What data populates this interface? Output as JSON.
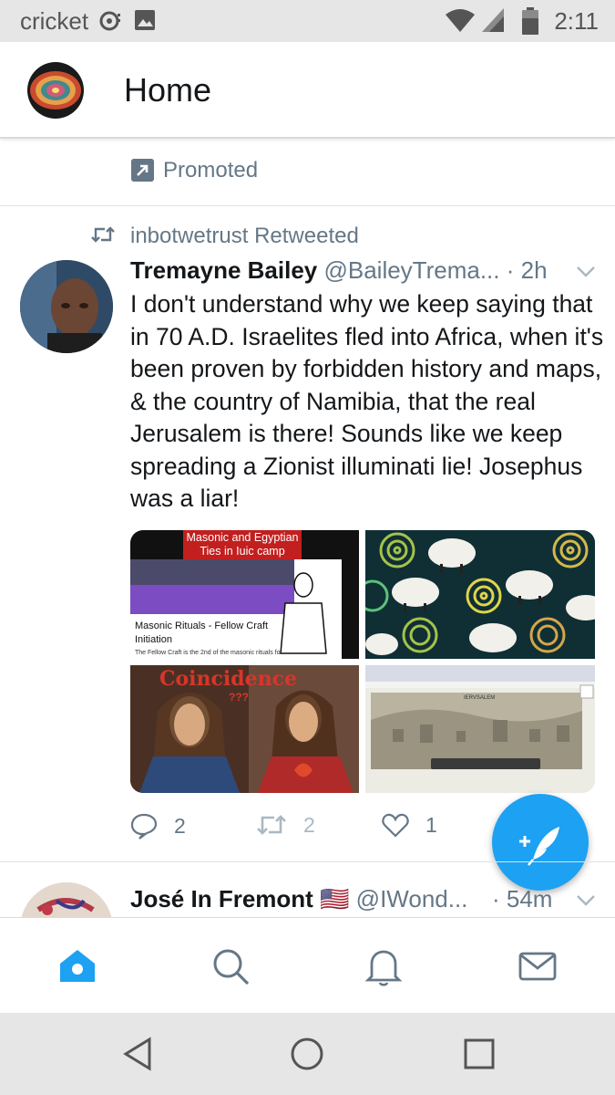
{
  "status_bar": {
    "carrier": "cricket",
    "time": "2:11",
    "icons": [
      "notification-icon",
      "image-icon",
      "wifi-icon",
      "signal-icon",
      "battery-icon"
    ]
  },
  "header": {
    "title": "Home"
  },
  "promoted": {
    "label": "Promoted"
  },
  "tweet": {
    "retweet_label": "inbotwetrust Retweeted",
    "author_name": "Tremayne Bailey",
    "author_handle": "@BaileyTrema...",
    "time": "· 2h",
    "text": "I don't understand why we keep saying that in 70 A.D. Israelites fled into Africa, when it's been proven by forbidden history and maps, & the country of Namibia, that the real Jerusalem is there! Sounds like we keep spreading a Zionist illuminati lie! Josephus was a liar!",
    "media": {
      "image1_title_line1": "Masonic and Egyptian",
      "image1_title_line2": "Ties in Iuic camp",
      "image1_caption_line1": "Masonic Rituals - Fellow Craft",
      "image1_caption_line2": "Initiation",
      "image1_small_text": "The Fellow Craft is the 2nd of the masonic rituals for",
      "image3_text": "Coincidence",
      "image3_subtext": "???",
      "image4_text": "IERVSALEM"
    },
    "reply_count": "2",
    "retweet_count": "2",
    "like_count": "1"
  },
  "next_tweet": {
    "author_name": "José In Fremont",
    "flag": "🇺🇸",
    "author_handle": "@IWond...",
    "time": "· 54m"
  },
  "colors": {
    "accent": "#1da1f2",
    "secondary_text": "#657786",
    "primary_text": "#14171a"
  }
}
